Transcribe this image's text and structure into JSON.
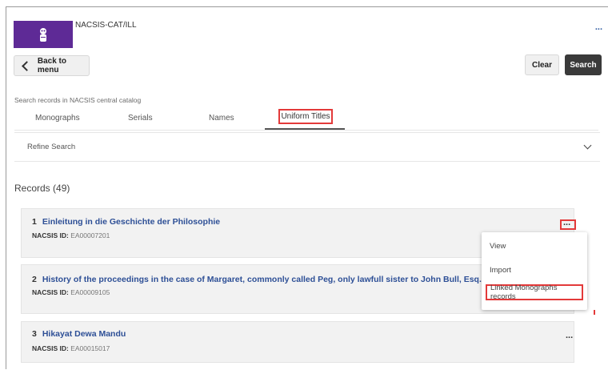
{
  "header": {
    "app_title": "NACSIS-CAT/ILL",
    "more_icon": "ellipsis-icon",
    "more_label": "...",
    "logo_color": "#5e2a96"
  },
  "toolbar": {
    "back_label": "Back to menu",
    "clear_label": "Clear",
    "search_label": "Search"
  },
  "search": {
    "hint": "Search records in NACSIS central catalog",
    "tabs": [
      {
        "label": "Monographs"
      },
      {
        "label": "Serials"
      },
      {
        "label": "Names"
      },
      {
        "label": "Uniform Titles",
        "active": true
      }
    ]
  },
  "refine": {
    "label": "Refine Search"
  },
  "records": {
    "heading": "Records (49)",
    "id_label": "NACSIS ID:",
    "items": [
      {
        "num": "1",
        "title": "Einleitung in die Geschichte der Philosophie",
        "id": "EA00007201",
        "menu": "..."
      },
      {
        "num": "2",
        "title": "History of the proceedings in the case of Margaret, commonly called Peg, only lawfull sister to John Bull, Esq.",
        "id": "EA00009105",
        "menu": "..."
      },
      {
        "num": "3",
        "title": "Hikayat Dewa Mandu",
        "id": "EA00015017",
        "menu": "..."
      }
    ]
  },
  "dropdown": {
    "items": [
      "View",
      "Import",
      "Linked Monographs records"
    ]
  },
  "colors": {
    "accent": "#2d4f96",
    "highlight": "#e33a3a",
    "primary_button": "#3a3a3a"
  }
}
